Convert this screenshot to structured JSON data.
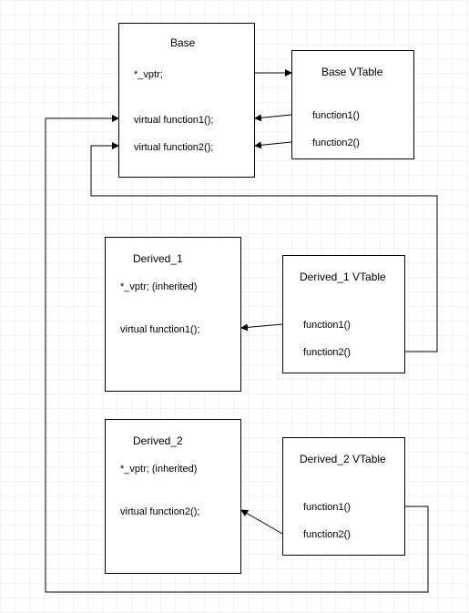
{
  "base": {
    "title": "Base",
    "vptr": "*_vptr;",
    "fn1": "virtual function1();",
    "fn2": "virtual function2();"
  },
  "base_vtable": {
    "title": "Base VTable",
    "fn1": "function1()",
    "fn2": "function2()"
  },
  "derived1": {
    "title": "Derived_1",
    "vptr": "*_vptr; (inherited)",
    "fn1": "virtual function1();"
  },
  "derived1_vtable": {
    "title": "Derived_1 VTable",
    "fn1": "function1()",
    "fn2": "function2()"
  },
  "derived2": {
    "title": "Derived_2",
    "vptr": "*_vptr; (inherited)",
    "fn2": "virtual function2();"
  },
  "derived2_vtable": {
    "title": "Derived_2 VTable",
    "fn1": "function1()",
    "fn2": "function2()"
  }
}
